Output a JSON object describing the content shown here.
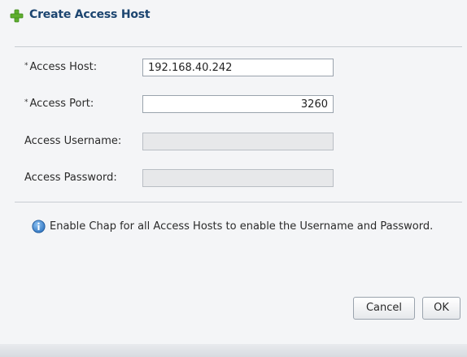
{
  "dialog": {
    "title": "Create Access Host",
    "title_icon": "plus-icon"
  },
  "form": {
    "required_marker": "*",
    "host": {
      "label": "Access Host:",
      "value": "192.168.40.242",
      "required": true
    },
    "port": {
      "label": "Access Port:",
      "value": "3260",
      "required": true
    },
    "username": {
      "label": "Access Username:",
      "value": "",
      "disabled": true
    },
    "password": {
      "label": "Access Password:",
      "value": "",
      "disabled": true
    }
  },
  "info": {
    "icon": "info-icon",
    "text": "Enable Chap for all Access Hosts to enable the Username and Password."
  },
  "buttons": {
    "cancel": "Cancel",
    "ok": "OK"
  },
  "colors": {
    "title": "#1c4570",
    "plus_icon": "#5fae2e",
    "info_icon": "#2f74c0"
  }
}
